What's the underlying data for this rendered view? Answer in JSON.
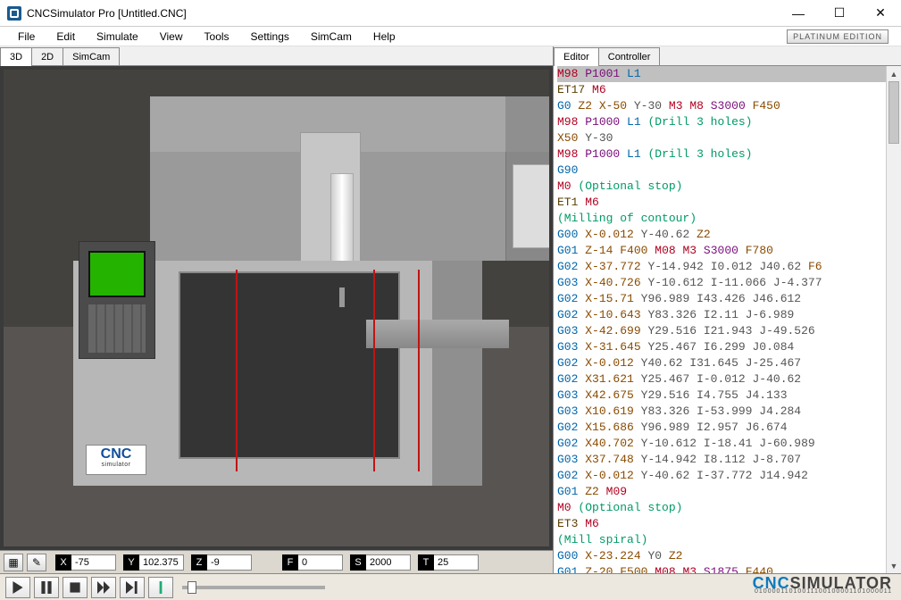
{
  "window": {
    "title": "CNCSimulator Pro [Untitled.CNC]",
    "minimize_glyph": "—",
    "maximize_glyph": "☐",
    "close_glyph": "✕"
  },
  "menubar": {
    "items": [
      "File",
      "Edit",
      "Simulate",
      "View",
      "Tools",
      "Settings",
      "SimCam",
      "Help"
    ],
    "edition_badge": "PLATINUM EDITION"
  },
  "left_tabs": {
    "items": [
      "3D",
      "2D",
      "SimCam"
    ],
    "active": 0
  },
  "right_tabs": {
    "items": [
      "Editor",
      "Controller"
    ],
    "active": 0
  },
  "viewport": {
    "logo_text": "CNC",
    "logo_sub": "simulator"
  },
  "status_strip": {
    "tool_icons": [
      "grid-icon",
      "pencil-icon"
    ],
    "coords": [
      {
        "label": "X",
        "value": "-75"
      },
      {
        "label": "Y",
        "value": "102.375"
      },
      {
        "label": "Z",
        "value": "-9"
      },
      {
        "label": "F",
        "value": "0"
      },
      {
        "label": "S",
        "value": "2000"
      },
      {
        "label": "T",
        "value": "25"
      }
    ]
  },
  "editor": {
    "highlighted_line": 0,
    "lines": [
      [
        {
          "t": "m",
          "v": "M98"
        },
        {
          "t": "",
          "v": " "
        },
        {
          "t": "p",
          "v": "P1001"
        },
        {
          "t": "",
          "v": " "
        },
        {
          "t": "l",
          "v": "L1"
        }
      ],
      [
        {
          "t": "et",
          "v": "ET17"
        },
        {
          "t": "",
          "v": " "
        },
        {
          "t": "m",
          "v": "M6"
        }
      ],
      [
        {
          "t": "g",
          "v": "G0"
        },
        {
          "t": "",
          "v": " "
        },
        {
          "t": "z",
          "v": "Z2"
        },
        {
          "t": "",
          "v": " "
        },
        {
          "t": "x",
          "v": "X-50"
        },
        {
          "t": "",
          "v": " "
        },
        {
          "t": "y",
          "v": "Y-30"
        },
        {
          "t": "",
          "v": " "
        },
        {
          "t": "m",
          "v": "M3"
        },
        {
          "t": "",
          "v": " "
        },
        {
          "t": "m",
          "v": "M8"
        },
        {
          "t": "",
          "v": " "
        },
        {
          "t": "s",
          "v": "S3000"
        },
        {
          "t": "",
          "v": " "
        },
        {
          "t": "f",
          "v": "F450"
        }
      ],
      [
        {
          "t": "m",
          "v": "M98"
        },
        {
          "t": "",
          "v": " "
        },
        {
          "t": "p",
          "v": "P1000"
        },
        {
          "t": "",
          "v": " "
        },
        {
          "t": "l",
          "v": "L1"
        },
        {
          "t": "",
          "v": " "
        },
        {
          "t": "c",
          "v": "(Drill 3 holes)"
        }
      ],
      [
        {
          "t": "x",
          "v": "X50"
        },
        {
          "t": "",
          "v": " "
        },
        {
          "t": "y",
          "v": "Y-30"
        }
      ],
      [
        {
          "t": "m",
          "v": "M98"
        },
        {
          "t": "",
          "v": " "
        },
        {
          "t": "p",
          "v": "P1000"
        },
        {
          "t": "",
          "v": " "
        },
        {
          "t": "l",
          "v": "L1"
        },
        {
          "t": "",
          "v": " "
        },
        {
          "t": "c",
          "v": "(Drill 3 holes)"
        }
      ],
      [
        {
          "t": "g",
          "v": "G90"
        }
      ],
      [
        {
          "t": "m",
          "v": "M0"
        },
        {
          "t": "",
          "v": " "
        },
        {
          "t": "c",
          "v": "(Optional stop)"
        }
      ],
      [
        {
          "t": "et",
          "v": "ET1"
        },
        {
          "t": "",
          "v": " "
        },
        {
          "t": "m",
          "v": "M6"
        }
      ],
      [
        {
          "t": "c",
          "v": "(Milling of contour)"
        }
      ],
      [
        {
          "t": "g",
          "v": "G00"
        },
        {
          "t": "",
          "v": " "
        },
        {
          "t": "x",
          "v": "X-0.012"
        },
        {
          "t": "",
          "v": " "
        },
        {
          "t": "y",
          "v": "Y-40.62"
        },
        {
          "t": "",
          "v": " "
        },
        {
          "t": "z",
          "v": "Z2"
        }
      ],
      [
        {
          "t": "g",
          "v": "G01"
        },
        {
          "t": "",
          "v": " "
        },
        {
          "t": "z",
          "v": "Z-14"
        },
        {
          "t": "",
          "v": " "
        },
        {
          "t": "f",
          "v": "F400"
        },
        {
          "t": "",
          "v": " "
        },
        {
          "t": "m",
          "v": "M08"
        },
        {
          "t": "",
          "v": " "
        },
        {
          "t": "m",
          "v": "M3"
        },
        {
          "t": "",
          "v": " "
        },
        {
          "t": "s",
          "v": "S3000"
        },
        {
          "t": "",
          "v": " "
        },
        {
          "t": "f",
          "v": "F780"
        }
      ],
      [
        {
          "t": "g",
          "v": "G02"
        },
        {
          "t": "",
          "v": " "
        },
        {
          "t": "x",
          "v": "X-37.772"
        },
        {
          "t": "",
          "v": " "
        },
        {
          "t": "y",
          "v": "Y-14.942"
        },
        {
          "t": "",
          "v": " "
        },
        {
          "t": "i",
          "v": "I0.012"
        },
        {
          "t": "",
          "v": " "
        },
        {
          "t": "i",
          "v": "J40.62"
        },
        {
          "t": "",
          "v": " "
        },
        {
          "t": "f",
          "v": "F6"
        }
      ],
      [
        {
          "t": "g",
          "v": "G03"
        },
        {
          "t": "",
          "v": " "
        },
        {
          "t": "x",
          "v": "X-40.726"
        },
        {
          "t": "",
          "v": " "
        },
        {
          "t": "y",
          "v": "Y-10.612"
        },
        {
          "t": "",
          "v": " "
        },
        {
          "t": "i",
          "v": "I-11.066"
        },
        {
          "t": "",
          "v": " "
        },
        {
          "t": "i",
          "v": "J-4.377"
        }
      ],
      [
        {
          "t": "g",
          "v": "G02"
        },
        {
          "t": "",
          "v": " "
        },
        {
          "t": "x",
          "v": "X-15.71"
        },
        {
          "t": "",
          "v": " "
        },
        {
          "t": "y",
          "v": "Y96.989"
        },
        {
          "t": "",
          "v": " "
        },
        {
          "t": "i",
          "v": "I43.426"
        },
        {
          "t": "",
          "v": " "
        },
        {
          "t": "i",
          "v": "J46.612"
        }
      ],
      [
        {
          "t": "g",
          "v": "G02"
        },
        {
          "t": "",
          "v": " "
        },
        {
          "t": "x",
          "v": "X-10.643"
        },
        {
          "t": "",
          "v": " "
        },
        {
          "t": "y",
          "v": "Y83.326"
        },
        {
          "t": "",
          "v": " "
        },
        {
          "t": "i",
          "v": "I2.11"
        },
        {
          "t": "",
          "v": " "
        },
        {
          "t": "i",
          "v": "J-6.989"
        }
      ],
      [
        {
          "t": "g",
          "v": "G03"
        },
        {
          "t": "",
          "v": " "
        },
        {
          "t": "x",
          "v": "X-42.699"
        },
        {
          "t": "",
          "v": " "
        },
        {
          "t": "y",
          "v": "Y29.516"
        },
        {
          "t": "",
          "v": " "
        },
        {
          "t": "i",
          "v": "I21.943"
        },
        {
          "t": "",
          "v": " "
        },
        {
          "t": "i",
          "v": "J-49.526"
        }
      ],
      [
        {
          "t": "g",
          "v": "G03"
        },
        {
          "t": "",
          "v": " "
        },
        {
          "t": "x",
          "v": "X-31.645"
        },
        {
          "t": "",
          "v": " "
        },
        {
          "t": "y",
          "v": "Y25.467"
        },
        {
          "t": "",
          "v": " "
        },
        {
          "t": "i",
          "v": "I6.299"
        },
        {
          "t": "",
          "v": " "
        },
        {
          "t": "i",
          "v": "J0.084"
        }
      ],
      [
        {
          "t": "g",
          "v": "G02"
        },
        {
          "t": "",
          "v": " "
        },
        {
          "t": "x",
          "v": "X-0.012"
        },
        {
          "t": "",
          "v": " "
        },
        {
          "t": "y",
          "v": "Y40.62"
        },
        {
          "t": "",
          "v": " "
        },
        {
          "t": "i",
          "v": "I31.645"
        },
        {
          "t": "",
          "v": " "
        },
        {
          "t": "i",
          "v": "J-25.467"
        }
      ],
      [
        {
          "t": "g",
          "v": "G02"
        },
        {
          "t": "",
          "v": " "
        },
        {
          "t": "x",
          "v": "X31.621"
        },
        {
          "t": "",
          "v": " "
        },
        {
          "t": "y",
          "v": "Y25.467"
        },
        {
          "t": "",
          "v": " "
        },
        {
          "t": "i",
          "v": "I-0.012"
        },
        {
          "t": "",
          "v": " "
        },
        {
          "t": "i",
          "v": "J-40.62"
        }
      ],
      [
        {
          "t": "g",
          "v": "G03"
        },
        {
          "t": "",
          "v": " "
        },
        {
          "t": "x",
          "v": "X42.675"
        },
        {
          "t": "",
          "v": " "
        },
        {
          "t": "y",
          "v": "Y29.516"
        },
        {
          "t": "",
          "v": " "
        },
        {
          "t": "i",
          "v": "I4.755"
        },
        {
          "t": "",
          "v": " "
        },
        {
          "t": "i",
          "v": "J4.133"
        }
      ],
      [
        {
          "t": "g",
          "v": "G03"
        },
        {
          "t": "",
          "v": " "
        },
        {
          "t": "x",
          "v": "X10.619"
        },
        {
          "t": "",
          "v": " "
        },
        {
          "t": "y",
          "v": "Y83.326"
        },
        {
          "t": "",
          "v": " "
        },
        {
          "t": "i",
          "v": "I-53.999"
        },
        {
          "t": "",
          "v": " "
        },
        {
          "t": "i",
          "v": "J4.284"
        }
      ],
      [
        {
          "t": "g",
          "v": "G02"
        },
        {
          "t": "",
          "v": " "
        },
        {
          "t": "x",
          "v": "X15.686"
        },
        {
          "t": "",
          "v": " "
        },
        {
          "t": "y",
          "v": "Y96.989"
        },
        {
          "t": "",
          "v": " "
        },
        {
          "t": "i",
          "v": "I2.957"
        },
        {
          "t": "",
          "v": " "
        },
        {
          "t": "i",
          "v": "J6.674"
        }
      ],
      [
        {
          "t": "g",
          "v": "G02"
        },
        {
          "t": "",
          "v": " "
        },
        {
          "t": "x",
          "v": "X40.702"
        },
        {
          "t": "",
          "v": " "
        },
        {
          "t": "y",
          "v": "Y-10.612"
        },
        {
          "t": "",
          "v": " "
        },
        {
          "t": "i",
          "v": "I-18.41"
        },
        {
          "t": "",
          "v": " "
        },
        {
          "t": "i",
          "v": "J-60.989"
        }
      ],
      [
        {
          "t": "g",
          "v": "G03"
        },
        {
          "t": "",
          "v": " "
        },
        {
          "t": "x",
          "v": "X37.748"
        },
        {
          "t": "",
          "v": " "
        },
        {
          "t": "y",
          "v": "Y-14.942"
        },
        {
          "t": "",
          "v": " "
        },
        {
          "t": "i",
          "v": "I8.112"
        },
        {
          "t": "",
          "v": " "
        },
        {
          "t": "i",
          "v": "J-8.707"
        }
      ],
      [
        {
          "t": "g",
          "v": "G02"
        },
        {
          "t": "",
          "v": " "
        },
        {
          "t": "x",
          "v": "X-0.012"
        },
        {
          "t": "",
          "v": " "
        },
        {
          "t": "y",
          "v": "Y-40.62"
        },
        {
          "t": "",
          "v": " "
        },
        {
          "t": "i",
          "v": "I-37.772"
        },
        {
          "t": "",
          "v": " "
        },
        {
          "t": "i",
          "v": "J14.942"
        }
      ],
      [
        {
          "t": "g",
          "v": "G01"
        },
        {
          "t": "",
          "v": " "
        },
        {
          "t": "z",
          "v": "Z2"
        },
        {
          "t": "",
          "v": " "
        },
        {
          "t": "m",
          "v": "M09"
        }
      ],
      [
        {
          "t": "m",
          "v": "M0"
        },
        {
          "t": "",
          "v": " "
        },
        {
          "t": "c",
          "v": "(Optional stop)"
        }
      ],
      [
        {
          "t": "et",
          "v": "ET3"
        },
        {
          "t": "",
          "v": " "
        },
        {
          "t": "m",
          "v": "M6"
        }
      ],
      [
        {
          "t": "c",
          "v": "(Mill spiral)"
        }
      ],
      [
        {
          "t": "g",
          "v": "G00"
        },
        {
          "t": "",
          "v": " "
        },
        {
          "t": "x",
          "v": "X-23.224"
        },
        {
          "t": "",
          "v": " "
        },
        {
          "t": "y",
          "v": "Y0"
        },
        {
          "t": "",
          "v": " "
        },
        {
          "t": "z",
          "v": "Z2"
        }
      ],
      [
        {
          "t": "g",
          "v": "G01"
        },
        {
          "t": "",
          "v": " "
        },
        {
          "t": "z",
          "v": "Z-20"
        },
        {
          "t": "",
          "v": " "
        },
        {
          "t": "f",
          "v": "F500"
        },
        {
          "t": "",
          "v": " "
        },
        {
          "t": "m",
          "v": "M08"
        },
        {
          "t": "",
          "v": " "
        },
        {
          "t": "m",
          "v": "M3"
        },
        {
          "t": "",
          "v": " "
        },
        {
          "t": "s",
          "v": "S1875"
        },
        {
          "t": "",
          "v": " "
        },
        {
          "t": "f",
          "v": "F440"
        }
      ]
    ]
  },
  "playback": {
    "buttons": [
      "play",
      "pause",
      "stop",
      "fast-forward",
      "step",
      "info"
    ]
  },
  "footer_brand": {
    "text_a": "CNC",
    "text_b": "SIMULATOR",
    "binary": "01000011010011100100001101000011"
  }
}
